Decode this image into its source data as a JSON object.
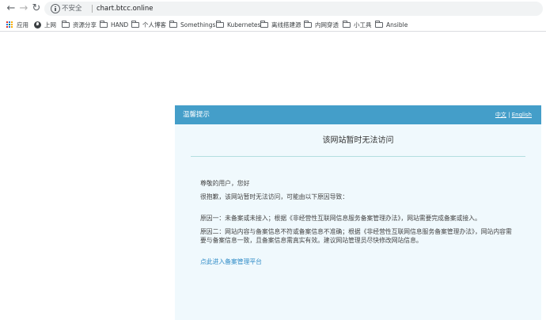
{
  "browser": {
    "security_label": "不安全",
    "url": "chart.btcc.online"
  },
  "bookmarks": [
    {
      "label": "应用",
      "icon": "apps-icon"
    },
    {
      "label": "上网",
      "icon": "globe-icon"
    },
    {
      "label": "资源分享",
      "icon": "folder-icon"
    },
    {
      "label": "HAND",
      "icon": "folder-icon"
    },
    {
      "label": "个人博客",
      "icon": "folder-icon"
    },
    {
      "label": "Somethings",
      "icon": "folder-icon"
    },
    {
      "label": "Kubernetes",
      "icon": "folder-icon"
    },
    {
      "label": "离线搭建源",
      "icon": "folder-icon"
    },
    {
      "label": "内网穿透",
      "icon": "folder-icon"
    },
    {
      "label": "小工具",
      "icon": "folder-icon"
    },
    {
      "label": "Ansible",
      "icon": "folder-icon"
    }
  ],
  "notice": {
    "title": "温馨提示",
    "lang_zh": "中文",
    "lang_sep": "|",
    "lang_en": "English",
    "heading": "该网站暂时无法访问",
    "greeting": "尊敬的用户，您好",
    "apology": "很抱歉，该网站暂时无法访问，可能由以下原因导致：",
    "reason1": "原因一：未备案或未接入；根据《非经营性互联网信息服务备案管理办法》，网站需要完成备案或接入。",
    "reason2": "原因二：网站内容与备案信息不符或备案信息不准确；根据《非经营性互联网信息服务备案管理办法》，网站内容需要与备案信息一致，且备案信息需真实有效。建议网站管理员尽快修改网站信息。",
    "portal_link": "点此进入备案管理平台"
  },
  "colors": {
    "header_blue": "#449ec9",
    "panel_bg": "#f0f9fd",
    "link_blue": "#2e8bc7"
  }
}
